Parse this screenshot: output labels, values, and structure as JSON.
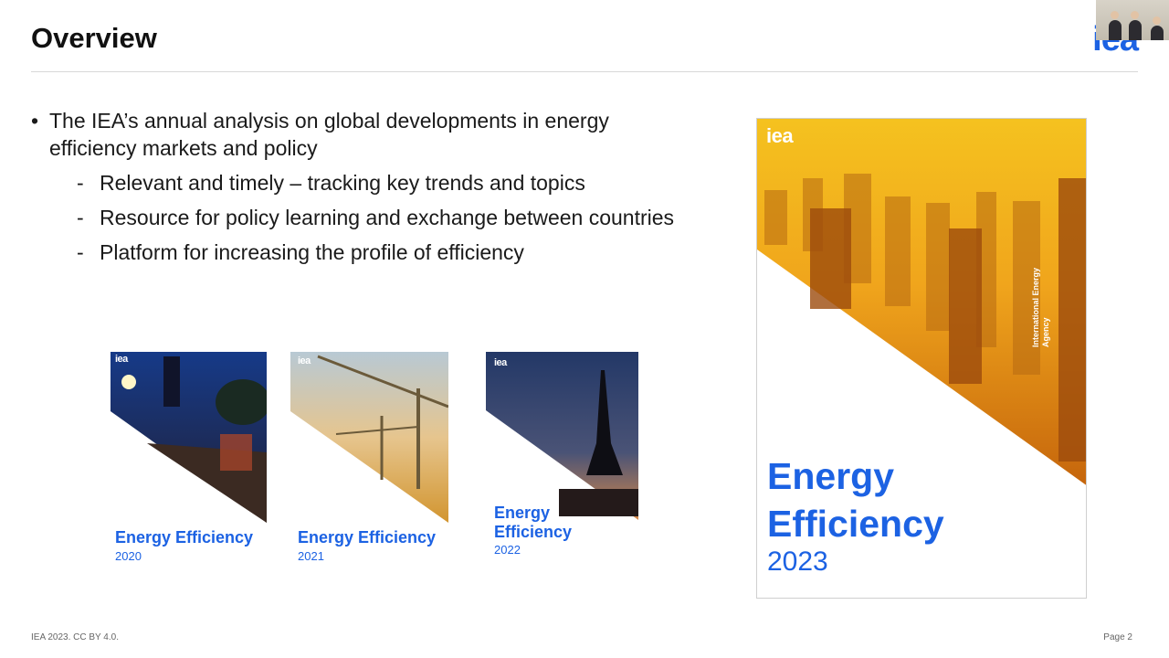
{
  "header": {
    "title": "Overview",
    "logo": "iea"
  },
  "bullets": {
    "main": "The IEA’s annual analysis on global developments in energy efficiency markets and policy",
    "subs": [
      "Relevant and timely – tracking key trends and topics",
      "Resource for policy learning and exchange between countries",
      "Platform for increasing the profile of efficiency"
    ]
  },
  "covers": [
    {
      "logo": "iea",
      "title": "Energy Efficiency",
      "year": "2020"
    },
    {
      "logo": "iea",
      "title": "Energy Efficiency",
      "year": "2021"
    },
    {
      "logo": "iea",
      "title_line1": "Energy",
      "title_line2": "Efficiency",
      "year": "2022"
    },
    {
      "logo": "iea",
      "title_line1": "Energy",
      "title_line2": "Efficiency",
      "year": "2023",
      "side_text": "International Energy Agency"
    }
  ],
  "footer": {
    "license": "IEA 2023. CC BY 4.0.",
    "page": "Page 2"
  },
  "colors": {
    "brand_blue": "#1c62e3"
  }
}
